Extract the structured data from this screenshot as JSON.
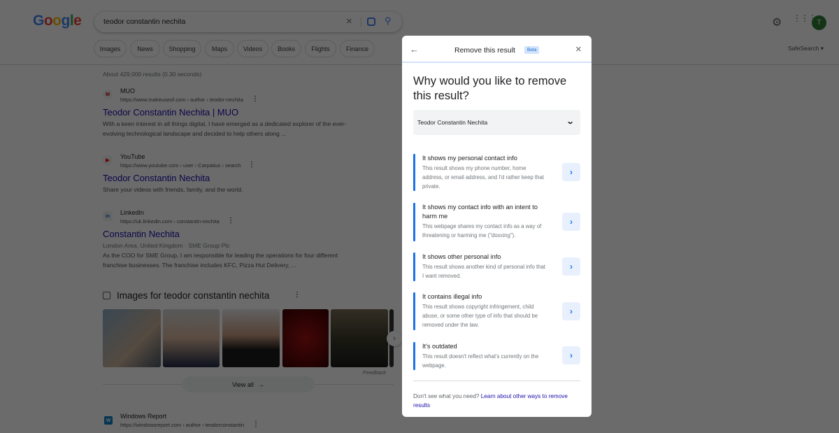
{
  "header": {
    "logo": "Google",
    "query": "teodor constantin nechita",
    "avatar": "T",
    "safesearch": "SafeSearch"
  },
  "chips": [
    "Images",
    "News",
    "Shopping",
    "Maps",
    "Videos",
    "Books",
    "Flights",
    "Finance"
  ],
  "stats": "About 429,000 results (0.30 seconds)",
  "results": [
    {
      "site": "MUO",
      "url": "https://www.makeuseof.com › author › teodor-nechita",
      "title": "Teodor Constantin Nechita | MUO",
      "snippet": "With a keen interest in all things digital, I have emerged as a dedicated explorer of the ever-evolving technological landscape and decided to help others along ...",
      "fav": "M"
    },
    {
      "site": "YouTube",
      "url": "https://www.youtube.com › user › Carpatius › search",
      "title": "Teodor Constantin Nechita",
      "snippet": "Share your videos with friends, family, and the world.",
      "fav": "▶"
    },
    {
      "site": "LinkedIn",
      "url": "https://uk.linkedin.com › constantin-nechita",
      "title": "Constantin Nechita",
      "meta": "London Area, United Kingdom · SME Group Plc",
      "snippet": "As the COO for SME Group, I am responsible for leading the operations for four different franchise businesses. The franchise includes KFC, Pizza Hut Delivery, ...",
      "fav": "in"
    },
    {
      "site": "Windows Report",
      "url": "https://windowsreport.com › author › teodorconstantin",
      "fav": "W"
    }
  ],
  "images": {
    "heading": "Images for teodor constantin nechita",
    "feedback": "Feedback",
    "view_all": "View all"
  },
  "modal": {
    "title": "Remove this result",
    "badge": "Beta",
    "question": "Why would you like to remove this result?",
    "selected": "Teodor Constantin Nechita",
    "options": [
      {
        "title": "It shows my personal contact info",
        "desc": "This result shows my phone number, home address, or email address, and I'd rather keep that private."
      },
      {
        "title": "It shows my contact info with an intent to harm me",
        "desc": "This webpage shares my contact info as a way of threatening or harming me (\"doxxing\")."
      },
      {
        "title": "It shows other personal info",
        "desc": "This result shows another kind of personal info that I want removed."
      },
      {
        "title": "It contains illegal info",
        "desc": "This result shows copyright infringement, child abuse, or some other type of info that should be removed under the law."
      },
      {
        "title": "It's outdated",
        "desc": "This result doesn't reflect what's currently on the webpage."
      }
    ],
    "footer_text": "Don't see what you need?",
    "footer_link": "Learn about other ways to remove results"
  }
}
